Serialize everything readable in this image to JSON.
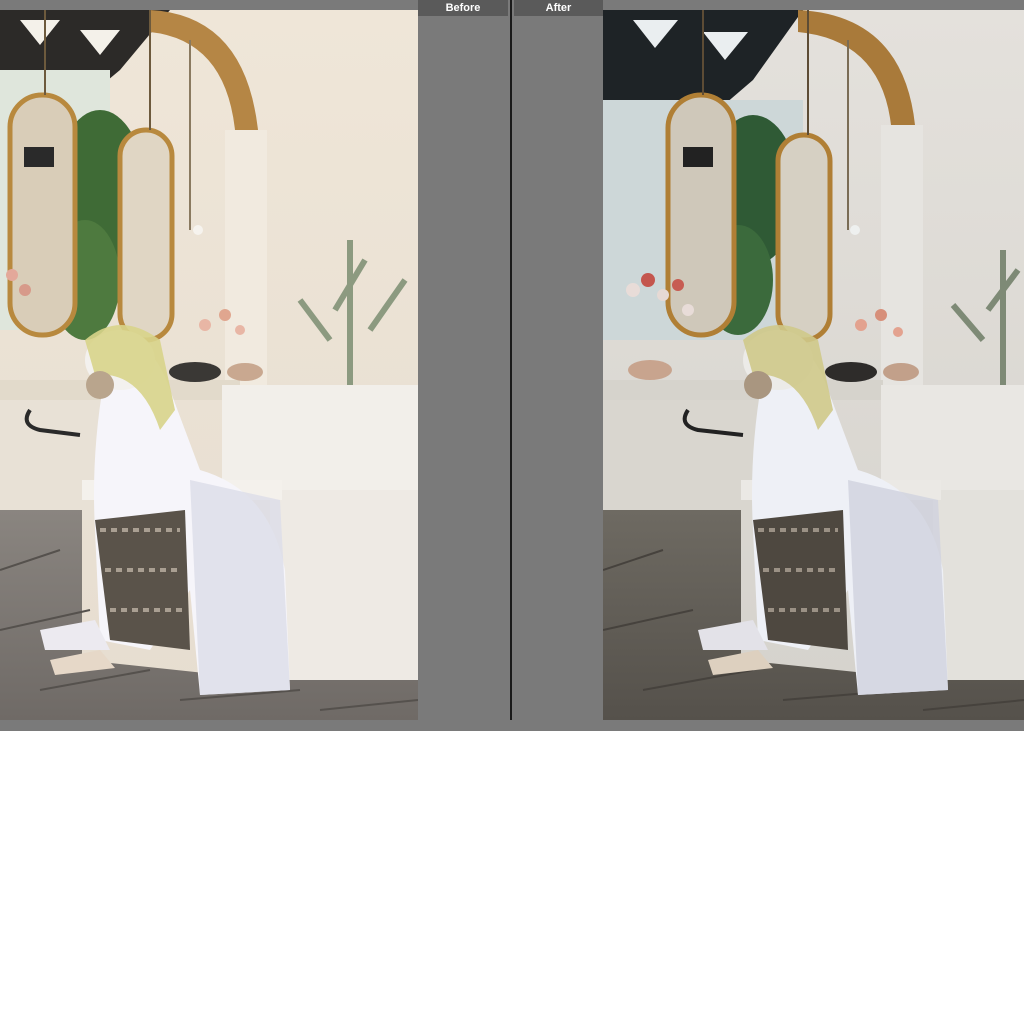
{
  "compare_view": {
    "before_label": "Before",
    "after_label": "After"
  },
  "photos": {
    "before": {
      "icon": "photo-before"
    },
    "after": {
      "icon": "photo-after"
    }
  }
}
